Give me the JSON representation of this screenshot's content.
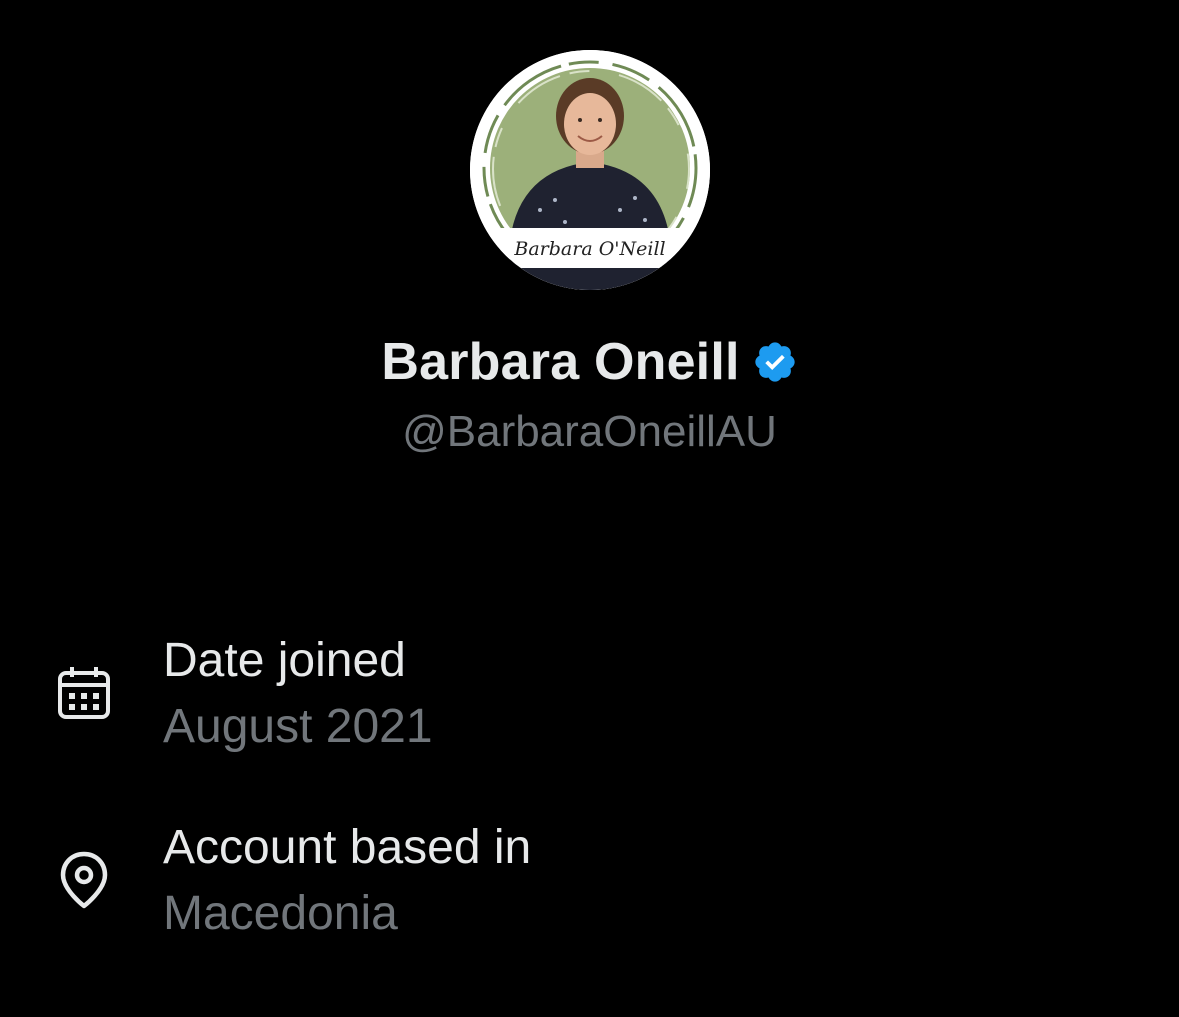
{
  "profile": {
    "avatar_caption": "Barbara O'Neill",
    "display_name": "Barbara Oneill",
    "verified": true,
    "handle": "@BarbaraOneillAU"
  },
  "info": [
    {
      "icon": "calendar-icon",
      "label": "Date joined",
      "value": "August 2021"
    },
    {
      "icon": "location-pin-icon",
      "label": "Account based in",
      "value": "Macedonia"
    }
  ],
  "colors": {
    "background": "#000000",
    "primary_text": "#e7e9ea",
    "secondary_text": "#71767b",
    "verified_blue": "#1d9bf0",
    "avatar_green": "#9cb07a"
  }
}
